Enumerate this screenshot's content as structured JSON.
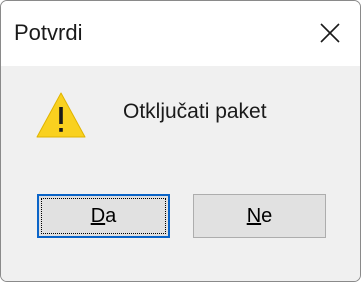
{
  "window": {
    "title": "Potvrdi"
  },
  "message": {
    "text": "Otključati paket"
  },
  "buttons": {
    "yes": {
      "label": "Da",
      "mnemonic": "D",
      "rest": "a"
    },
    "no": {
      "label": "Ne",
      "mnemonic": "N",
      "rest": "e"
    }
  },
  "icons": {
    "warning": "warning-icon",
    "close": "close-icon"
  },
  "colors": {
    "warning_yellow": "#f9d11f",
    "focus_border": "#0a64c8",
    "dialog_bg": "#f0f0f0",
    "titlebar_bg": "#ffffff"
  }
}
